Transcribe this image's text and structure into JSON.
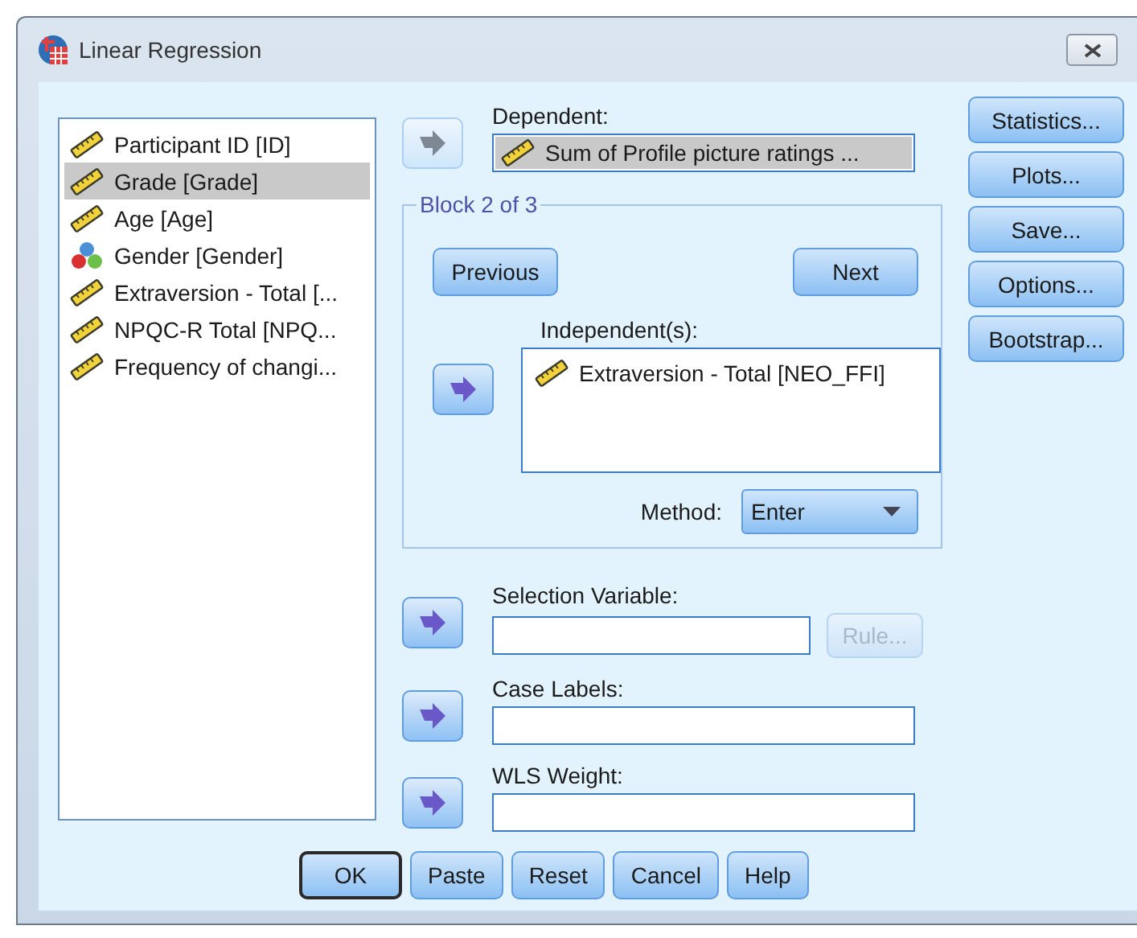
{
  "window": {
    "title": "Linear Regression"
  },
  "variables": [
    {
      "label": "Participant ID [ID]",
      "kind": "scale",
      "selected": false
    },
    {
      "label": "Grade [Grade]",
      "kind": "scale",
      "selected": true
    },
    {
      "label": "Age [Age]",
      "kind": "scale",
      "selected": false
    },
    {
      "label": "Gender [Gender]",
      "kind": "nominal",
      "selected": false
    },
    {
      "label": "Extraversion - Total [...",
      "kind": "scale",
      "selected": false
    },
    {
      "label": "NPQC-R Total [NPQ...",
      "kind": "scale",
      "selected": false
    },
    {
      "label": "Frequency of changi...",
      "kind": "scale",
      "selected": false
    }
  ],
  "dependent": {
    "label": "Dependent:",
    "arrow_disabled": true,
    "value": {
      "label": "Sum of Profile picture ratings ...",
      "kind": "scale"
    }
  },
  "block": {
    "title": "Block 2 of 3",
    "previous": "Previous",
    "next": "Next",
    "independents_label": "Independent(s):",
    "arrow_disabled": false,
    "independents": [
      {
        "label": "Extraversion - Total [NEO_FFI]",
        "kind": "scale"
      }
    ],
    "method_label": "Method:",
    "method": "Enter"
  },
  "fields": [
    {
      "label": "Selection Variable:",
      "arrow_disabled": false,
      "button": {
        "label": "Rule...",
        "disabled": true
      }
    },
    {
      "label": "Case Labels:",
      "arrow_disabled": false
    },
    {
      "label": "WLS Weight:",
      "arrow_disabled": false
    }
  ],
  "side_buttons": [
    "Statistics...",
    "Plots...",
    "Save...",
    "Options...",
    "Bootstrap..."
  ],
  "bottom_buttons": [
    {
      "label": "OK",
      "default": true
    },
    {
      "label": "Paste",
      "default": false
    },
    {
      "label": "Reset",
      "default": false
    },
    {
      "label": "Cancel",
      "default": false
    },
    {
      "label": "Help",
      "default": false
    }
  ]
}
